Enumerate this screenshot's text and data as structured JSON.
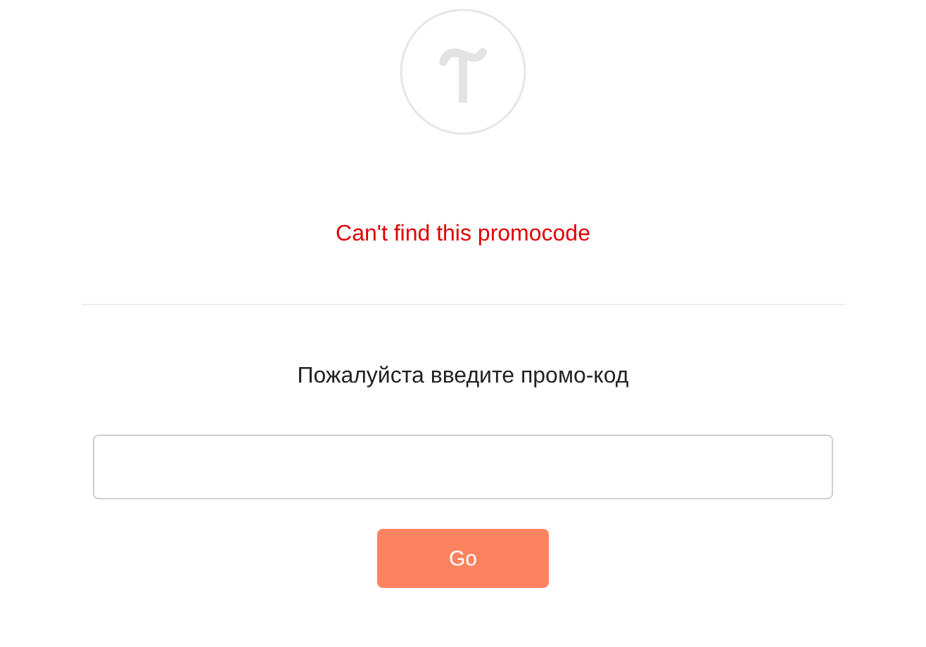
{
  "error": "Can't find this promocode",
  "prompt": "Пожалуйста введите промо-код",
  "button": "Go"
}
